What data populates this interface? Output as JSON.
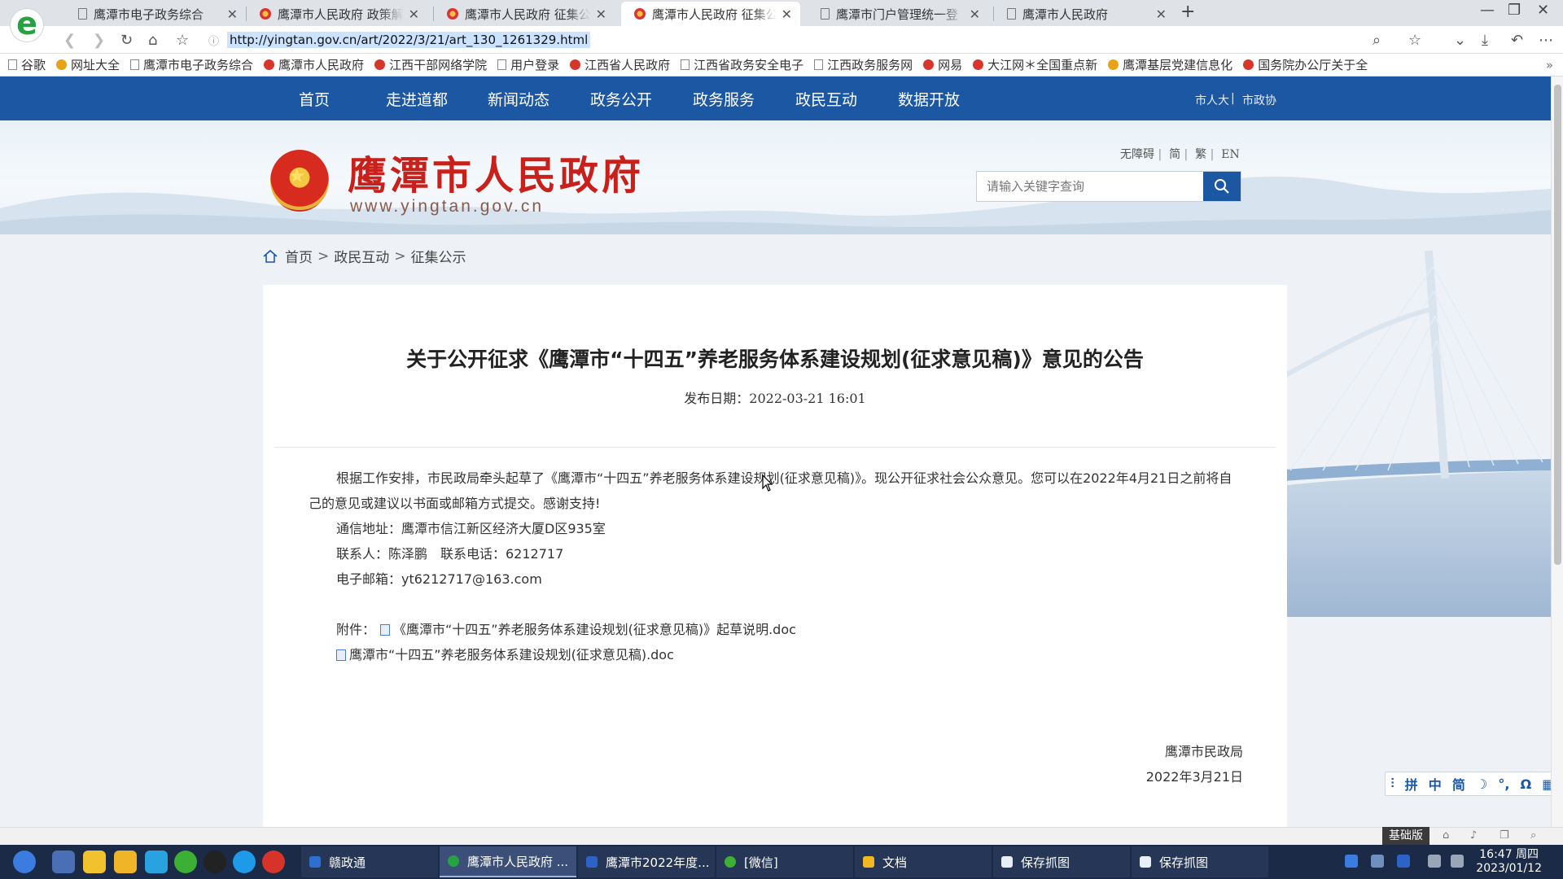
{
  "browser": {
    "tabs": [
      {
        "title": "鹰潭市电子政务综合",
        "icon": "doc-icon"
      },
      {
        "title": "鹰潭市人民政府 政策解",
        "icon": "gov-emblem-icon"
      },
      {
        "title": "鹰潭市人民政府 征集公",
        "icon": "gov-emblem-icon"
      },
      {
        "title": "鹰潭市人民政府 征集公",
        "icon": "gov-emblem-icon",
        "active": true
      },
      {
        "title": "鹰潭市门户管理统一登",
        "icon": "doc-icon"
      },
      {
        "title": "鹰潭市人民政府",
        "icon": "doc-icon"
      }
    ],
    "url": "http://yingtan.gov.cn/art/2022/3/21/art_130_1261329.html",
    "bookmarks": [
      "谷歌",
      "网址大全",
      "鹰潭市电子政务综合",
      "鹰潭市人民政府",
      "江西干部网络学院",
      "用户登录",
      "江西省人民政府",
      "江西省政务安全电子",
      "江西政务服务网",
      "网易",
      "大江网＊全国重点新",
      "鹰潭基层党建信息化",
      "国务院办公厅关于全"
    ]
  },
  "site": {
    "nav": [
      "首页",
      "走进道都",
      "新闻动态",
      "政务公开",
      "政务服务",
      "政民互动",
      "数据开放"
    ],
    "nav_side": [
      "市人大",
      "市政协"
    ],
    "title": "鹰潭市人民政府",
    "url_text": "www.yingtan.gov.cn",
    "header_links": [
      "无障碍",
      "简",
      "繁",
      "EN"
    ],
    "search_placeholder": "请输入关键字查询"
  },
  "breadcrumb": [
    "首页",
    "政民互动",
    "征集公示"
  ],
  "article": {
    "title": "关于公开征求《鹰潭市“十四五”养老服务体系建设规划(征求意见稿)》意见的公告",
    "date_label": "发布日期：",
    "date": "2022-03-21 16:01",
    "intro": "根据工作安排，市民政局牵头起草了《鹰潭市“十四五”养老服务体系建设规划(征求意见稿)》。现公开征求社会公众意见。您可以在2022年4月21日之前将自己的意见或建议以书面或邮箱方式提交。感谢支持!",
    "address": "通信地址：鹰潭市信江新区经济大厦D区935室",
    "contact": "联系人：陈泽鹏　联系电话：6212717",
    "email": "电子邮箱：yt6212717@163.com",
    "attach_label": "附件：",
    "attachments": [
      "《鹰潭市“十四五”养老服务体系建设规划(征求意见稿)》起草说明.doc",
      "鹰潭市“十四五”养老服务体系建设规划(征求意见稿).doc"
    ],
    "signer": "鹰潭市民政局",
    "sign_date": "2022年3月21日"
  },
  "ime": [
    "拼",
    "中",
    "简"
  ],
  "status_basic": "基础版",
  "taskbar": {
    "windows": [
      {
        "label": "赣政通",
        "color": "#2f6fd1"
      },
      {
        "label": "鹰潭市人民政府 ...",
        "color": "#27a243",
        "active": true
      },
      {
        "label": "鹰潭市2022年度...",
        "color": "#2b63c6"
      },
      {
        "label": "[微信]",
        "color": "#3cb034"
      },
      {
        "label": "文档",
        "color": "#f2b824"
      },
      {
        "label": "保存抓图",
        "color": "#e8eef5"
      },
      {
        "label": "保存抓图",
        "color": "#e8eef5"
      }
    ],
    "time": "16:47 周四",
    "date": "2023/01/12"
  }
}
